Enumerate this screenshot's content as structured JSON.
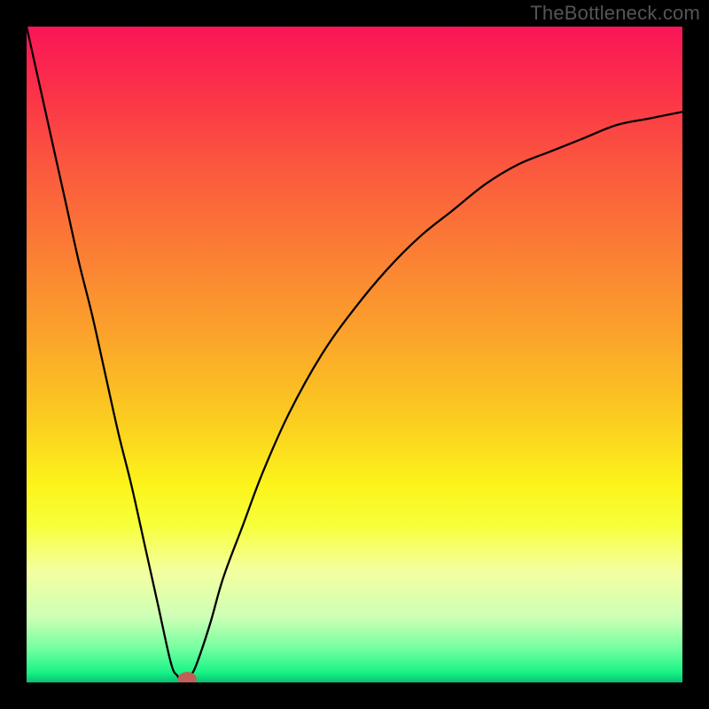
{
  "watermark": "TheBottleneck.com",
  "chart_data": {
    "type": "line",
    "title": "",
    "xlabel": "",
    "ylabel": "",
    "xlim": [
      0,
      100
    ],
    "ylim": [
      0,
      100
    ],
    "grid": false,
    "series": [
      {
        "name": "bottleneck-curve",
        "x": [
          0,
          2,
          4,
          6,
          8,
          10,
          12,
          14,
          16,
          18,
          20,
          22,
          23,
          24,
          25,
          26,
          28,
          30,
          33,
          36,
          40,
          45,
          50,
          55,
          60,
          65,
          70,
          75,
          80,
          85,
          90,
          95,
          100
        ],
        "values": [
          100,
          91,
          82,
          73,
          64,
          56,
          47,
          38,
          30,
          21,
          12,
          3,
          1,
          0,
          1,
          3,
          9,
          16,
          24,
          32,
          41,
          50,
          57,
          63,
          68,
          72,
          76,
          79,
          81,
          83,
          85,
          86,
          87
        ]
      }
    ],
    "marker": {
      "x": 24.5,
      "y": 0.5,
      "color": "#c06058",
      "radius": 1.3
    },
    "background_gradient": {
      "stops": [
        {
          "offset": 0.0,
          "color": "#fa1558"
        },
        {
          "offset": 0.1,
          "color": "#fb3248"
        },
        {
          "offset": 0.22,
          "color": "#fb5a3e"
        },
        {
          "offset": 0.35,
          "color": "#fb8034"
        },
        {
          "offset": 0.48,
          "color": "#fba62a"
        },
        {
          "offset": 0.6,
          "color": "#fbcd20"
        },
        {
          "offset": 0.7,
          "color": "#fcf41b"
        },
        {
          "offset": 0.76,
          "color": "#f7ff3a"
        },
        {
          "offset": 0.83,
          "color": "#f4ffa0"
        },
        {
          "offset": 0.9,
          "color": "#ceffb6"
        },
        {
          "offset": 0.95,
          "color": "#70ff9f"
        },
        {
          "offset": 0.985,
          "color": "#18f386"
        },
        {
          "offset": 1.0,
          "color": "#08c074"
        }
      ]
    }
  }
}
